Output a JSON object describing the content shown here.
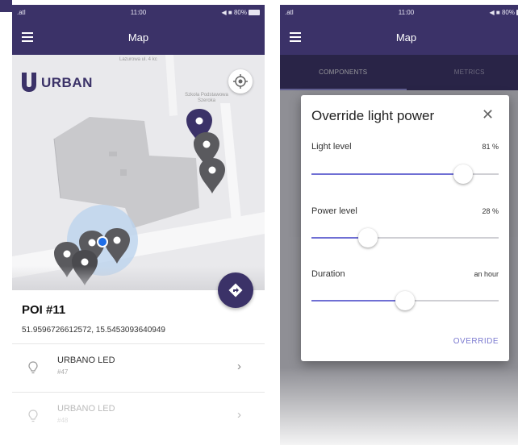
{
  "status": {
    "signal": ".atl",
    "time": "11:00",
    "indicators": "◀ ■ 80%"
  },
  "app": {
    "title": "Map"
  },
  "map": {
    "street_top": "Lazurowa ul. 4 kc",
    "street_right": "Szkoła Podstawowa\nSzeroka",
    "logo_text": "URBAN",
    "icons": [
      "menu-icon",
      "locate-icon",
      "navigate-icon",
      "map-pin-icon",
      "current-location-icon"
    ]
  },
  "poi": {
    "title": "POI #11",
    "coords": "51.9596726612572, 15.5453093640949"
  },
  "devices": [
    {
      "name": "URBANO LED",
      "id": "#47"
    },
    {
      "name": "URBANO LED",
      "id": "#48"
    }
  ],
  "tabs": [
    {
      "label": "COMPONENTS",
      "active": true
    },
    {
      "label": "METRICS",
      "active": false
    }
  ],
  "dialog": {
    "title": "Override light power",
    "close": "✕",
    "controls": [
      {
        "label": "Light level",
        "value_text": "81 %",
        "fraction": 0.81
      },
      {
        "label": "Power level",
        "value_text": "28 %",
        "fraction": 0.3
      },
      {
        "label": "Duration",
        "value_text": "an hour",
        "fraction": 0.5
      }
    ],
    "action": "OVERRIDE"
  },
  "colors": {
    "brand": "#3b3268",
    "accent": "#6f6fd4",
    "pin_active": "#3b3268",
    "pin_inactive": "#5a5a5e"
  }
}
